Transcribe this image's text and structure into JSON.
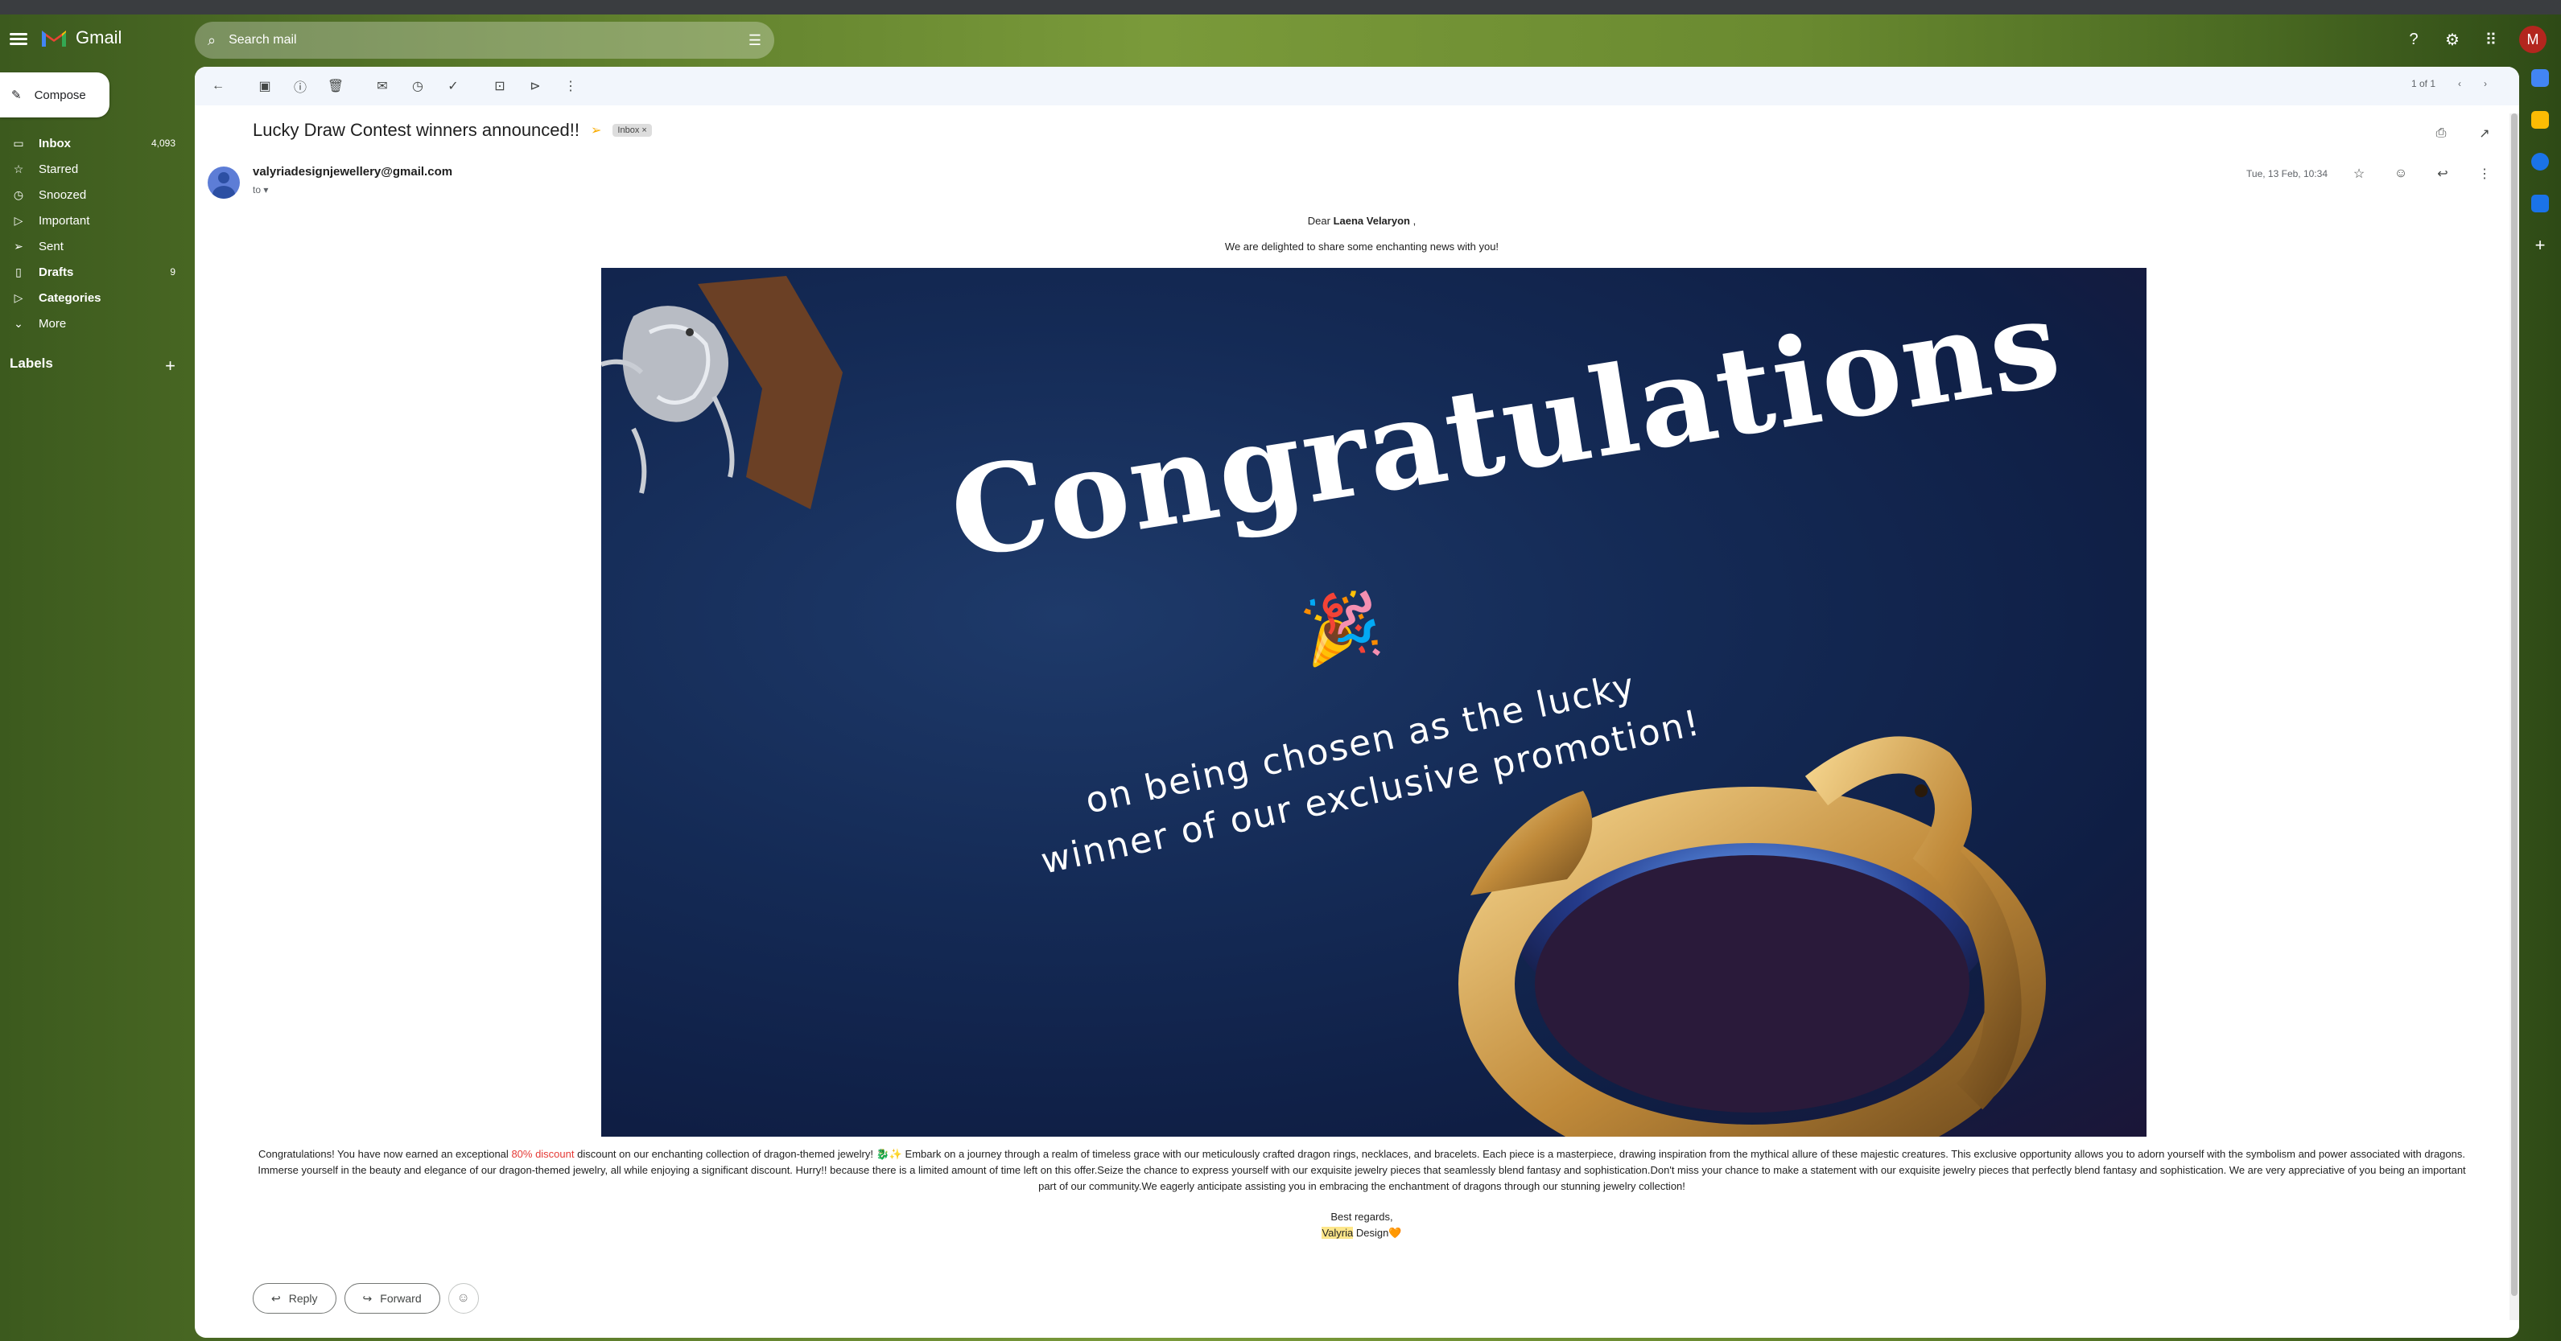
{
  "app": {
    "name": "Gmail"
  },
  "search": {
    "placeholder": "Search mail"
  },
  "compose": {
    "label": "Compose"
  },
  "sidebar": {
    "items": [
      {
        "label": "Inbox",
        "count": "4,093",
        "icon": "inbox-icon",
        "glyph": "▭"
      },
      {
        "label": "Starred",
        "count": "",
        "icon": "star-icon",
        "glyph": "☆"
      },
      {
        "label": "Snoozed",
        "count": "",
        "icon": "clock-icon",
        "glyph": "◷"
      },
      {
        "label": "Important",
        "count": "",
        "icon": "important-icon",
        "glyph": "▷"
      },
      {
        "label": "Sent",
        "count": "",
        "icon": "send-icon",
        "glyph": "➢"
      },
      {
        "label": "Drafts",
        "count": "9",
        "icon": "draft-icon",
        "glyph": "▯"
      },
      {
        "label": "Categories",
        "count": "",
        "icon": "label-icon",
        "glyph": "▷"
      },
      {
        "label": "More",
        "count": "",
        "icon": "chevron-down-icon",
        "glyph": "⌄"
      }
    ],
    "labels_heading": "Labels"
  },
  "pager": {
    "text": "1 of 1"
  },
  "email": {
    "subject": "Lucky Draw Contest winners announced!!",
    "label_chip": "Inbox",
    "sender": "valyriadesignjewellery@gmail.com",
    "to": "to",
    "date": "Tue, 13 Feb, 10:34",
    "greeting_prefix": "Dear",
    "recipient_name": "Laena Velaryon",
    "greeting_suffix": ",",
    "intro": "We are delighted to share some enchanting news with you!",
    "banner_title": "Congratulations",
    "banner_emoji": "🎉",
    "banner_subtitle": "on being chosen as the lucky winner of our exclusive promotion!",
    "para_1": "Congratulations! You have now earned an exceptional",
    "discount": "80% discount",
    "para_2": "discount on our enchanting collection of dragon-themed jewelry! 🐉✨ Embark on a journey through a realm of timeless grace with our meticulously crafted dragon rings, necklaces, and bracelets. Each piece is a masterpiece, drawing inspiration from the mythical allure of these majestic creatures. This exclusive opportunity allows you to adorn yourself with the symbolism and power associated with dragons. Immerse yourself in the beauty and elegance of our dragon-themed jewelry, all while enjoying a significant discount. Hurry!! because there is a limited amount of time left on this offer.Seize the chance to express yourself with our exquisite jewelry pieces that seamlessly blend fantasy and sophistication.Don't miss your chance to make a statement with our exquisite jewelry pieces that perfectly blend fantasy and sophistication. We are very appreciative of you being an important part of our community.We eagerly anticipate assisting you in embracing the enchantment of dragons through our stunning jewelry collection!",
    "regards": "Best regards,",
    "sign_highlight": "Valyria",
    "sign_rest": " Design🧡"
  },
  "actions": {
    "reply": "Reply",
    "forward": "Forward"
  },
  "user": {
    "avatar_letter": "M"
  },
  "colors": {
    "accent_red": "#e53935",
    "avatar_bg": "#b3261e",
    "highlight": "#fde68a"
  }
}
